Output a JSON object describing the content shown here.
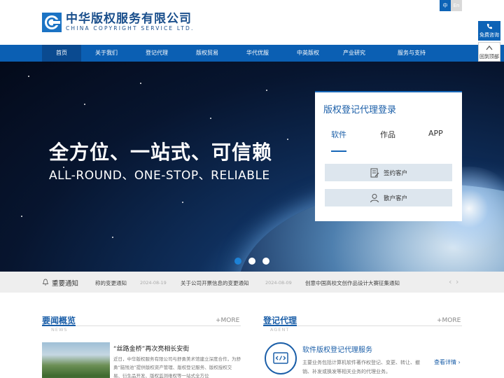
{
  "header": {
    "logo_cn": "中华版权服务有限公司",
    "logo_en": "CHINA COPYRIGHT SERVICE LTD.",
    "lang_zh": "中",
    "lang_en": "En"
  },
  "nav": {
    "items": [
      "首页",
      "关于我们",
      "登记代理",
      "版权贸易",
      "华代优服",
      "中英版权",
      "产业研究",
      "服务与支持"
    ]
  },
  "side": {
    "consult": "免费咨询",
    "totop": "回到顶部"
  },
  "banner": {
    "headline_cn": "全方位、一站式、可信赖",
    "headline_en": "ALL-ROUND、ONE-STOP、RELIABLE"
  },
  "login": {
    "title": "版权登记代理登录",
    "tabs": [
      "软件",
      "作品",
      "APP"
    ],
    "sign_client": "签约客户",
    "guest_client": "散户客户"
  },
  "notice": {
    "title": "重要通知",
    "items": [
      {
        "text": "称的变更通知",
        "date": "2024-08-19"
      },
      {
        "text": "关于公司开票信息的变更通知",
        "date": "2024-08-09"
      },
      {
        "text": "创意中国高校文创作品设计大赛征集通知",
        "date": ""
      }
    ]
  },
  "news": {
    "title": "要闻概览",
    "sub": "NEWS",
    "more": "+MORE",
    "headline": "“丝路金桥”再次亮相长安街",
    "text": "近日，中华版权服务有限公司与舒勇美术馆建立深度合作，为舒勇“脑残池”提供版权资产管理、版权登记服务、版权授权交易、衍生品开发、版权监测维权等一站式全方位"
  },
  "agent": {
    "title": "登记代理",
    "sub": "AGENT",
    "more": "+MORE",
    "service_title": "软件版权登记代理服务",
    "service_text": "主要业务包括计算机软件著作权登记、变更、转让、撤销、补发或换发等相关业务的代理业务。",
    "detail": "查看详情"
  },
  "colors": {
    "primary": "#0b5fb3",
    "nav_active": "#0a4a90",
    "accent_text": "#1a5ea8"
  }
}
